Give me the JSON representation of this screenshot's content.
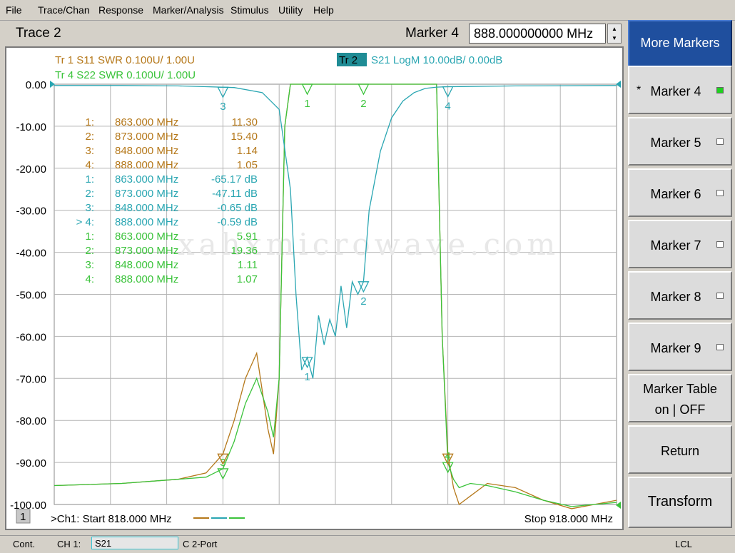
{
  "menu": [
    "File",
    "Trace/Chan",
    "Response",
    "Marker/Analysis",
    "Stimulus",
    "Utility",
    "Help"
  ],
  "header": {
    "trace_title": "Trace 2",
    "marker_label": "Marker 4",
    "marker_value": "888.000000000 MHz"
  },
  "colors": {
    "s11": "#b5781a",
    "s21": "#2aa6b2",
    "s22": "#3bc33b",
    "grid": "#b4b4b4",
    "plot_bg": "#ffffff",
    "active_key": "#1f4f9e"
  },
  "trace_legend": {
    "tr1": "Tr  1   S11 SWR 0.100U/  1.00U",
    "tr4": "Tr  4   S22 SWR 0.100U/  1.00U",
    "tr2_tag": "Tr  2",
    "tr2": "S21 LogM 10.00dB/  0.00dB"
  },
  "chart_data": {
    "type": "line",
    "y_ticks": [
      "0.00",
      "-10.00",
      "-20.00",
      "-30.00",
      "-40.00",
      "-50.00",
      "-60.00",
      "-70.00",
      "-80.00",
      "-90.00",
      "-100.00"
    ],
    "ylim": [
      -100,
      0
    ],
    "xlim": [
      818,
      918
    ],
    "x_unit": "MHz",
    "y_unit": "dB",
    "series": [
      {
        "name": "S21",
        "x": [
          818,
          830,
          840,
          845,
          850,
          855,
          858,
          860,
          861,
          862,
          863,
          864,
          865,
          866,
          867,
          868,
          869,
          870,
          871,
          872,
          873,
          874,
          876,
          878,
          880,
          882,
          884,
          886,
          888,
          900,
          918
        ],
        "y": [
          -0.3,
          -0.3,
          -0.4,
          -0.6,
          -0.8,
          -2,
          -6,
          -25,
          -50,
          -68,
          -65,
          -70,
          -55,
          -62,
          -56,
          -60,
          -48,
          -58,
          -47,
          -50,
          -47,
          -30,
          -16,
          -8,
          -4,
          -2,
          -1,
          -0.7,
          -0.6,
          -0.4,
          -0.3
        ]
      },
      {
        "name": "S11",
        "x": [
          818,
          830,
          840,
          845,
          848,
          850,
          852,
          854,
          856,
          857,
          858,
          859,
          860,
          862,
          864,
          866,
          868,
          870,
          872,
          874,
          876,
          878,
          880,
          882,
          884,
          886,
          887,
          888,
          889,
          890,
          892,
          895,
          900,
          905,
          910,
          918
        ],
        "y": [
          -95.5,
          -95,
          -94,
          -92.5,
          -88,
          -80,
          -70,
          -64,
          -82,
          -88,
          -70,
          -10,
          0,
          0,
          0,
          0,
          0,
          0,
          0,
          0,
          0,
          0,
          0,
          0,
          0,
          0,
          -60,
          -88,
          -96,
          -100,
          -98,
          -95,
          -96,
          -99,
          -101,
          -99
        ]
      },
      {
        "name": "S22",
        "x": [
          818,
          830,
          840,
          845,
          848,
          850,
          852,
          854,
          856,
          857,
          858,
          859,
          860,
          862,
          864,
          866,
          868,
          870,
          872,
          874,
          876,
          878,
          880,
          882,
          884,
          886,
          887,
          888,
          889,
          890,
          892,
          895,
          900,
          905,
          910,
          918
        ],
        "y": [
          -95.5,
          -95,
          -94,
          -93.5,
          -91.5,
          -85,
          -76,
          -70,
          -78,
          -84,
          -70,
          -10,
          0,
          0,
          0,
          0,
          0,
          0,
          0,
          0,
          0,
          0,
          0,
          0,
          0,
          0,
          -60,
          -90,
          -94,
          -96,
          -95,
          -95.5,
          -97,
          -99,
          -100.5,
          -99.5
        ]
      }
    ]
  },
  "marker_table": [
    {
      "label": "1:",
      "freq": "863.000 MHz",
      "value": "11.30",
      "color": "#b5781a"
    },
    {
      "label": "2:",
      "freq": "873.000 MHz",
      "value": "15.40",
      "color": "#b5781a"
    },
    {
      "label": "3:",
      "freq": "848.000 MHz",
      "value": "1.14",
      "color": "#b5781a"
    },
    {
      "label": "4:",
      "freq": "888.000 MHz",
      "value": "1.05",
      "color": "#b5781a"
    },
    {
      "label": "1:",
      "freq": "863.000 MHz",
      "value": "-65.17 dB",
      "color": "#2aa6b2"
    },
    {
      "label": "2:",
      "freq": "873.000 MHz",
      "value": "-47.11 dB",
      "color": "#2aa6b2"
    },
    {
      "label": "3:",
      "freq": "848.000 MHz",
      "value": "-0.65 dB",
      "color": "#2aa6b2"
    },
    {
      "label": "> 4:",
      "freq": "888.000 MHz",
      "value": "-0.59 dB",
      "color": "#2aa6b2"
    },
    {
      "label": "1:",
      "freq": "863.000 MHz",
      "value": "5.91",
      "color": "#3bc33b"
    },
    {
      "label": "2:",
      "freq": "873.000 MHz",
      "value": "19.36",
      "color": "#3bc33b"
    },
    {
      "label": "3:",
      "freq": "848.000 MHz",
      "value": "1.11",
      "color": "#3bc33b"
    },
    {
      "label": "4:",
      "freq": "888.000 MHz",
      "value": "1.07",
      "color": "#3bc33b"
    }
  ],
  "watermark": "xahxmicrowave.com",
  "footer": {
    "channel_num": "1",
    "start": ">Ch1: Start  818.000 MHz",
    "stop": "Stop  918.000 MHz"
  },
  "softkeys": {
    "more_markers": "More Markers",
    "marker4": "Marker 4",
    "marker4_star": "*",
    "marker5": "Marker 5",
    "marker6": "Marker 6",
    "marker7": "Marker 7",
    "marker8": "Marker 8",
    "marker9": "Marker 9",
    "marker_table_1": "Marker Table",
    "marker_table_2": "on | OFF",
    "return": "Return",
    "transform": "Transform"
  },
  "status": {
    "mode": "Cont.",
    "channel": "CH 1:",
    "measurement": "S21",
    "cal": "C  2-Port",
    "lcl": "LCL"
  }
}
